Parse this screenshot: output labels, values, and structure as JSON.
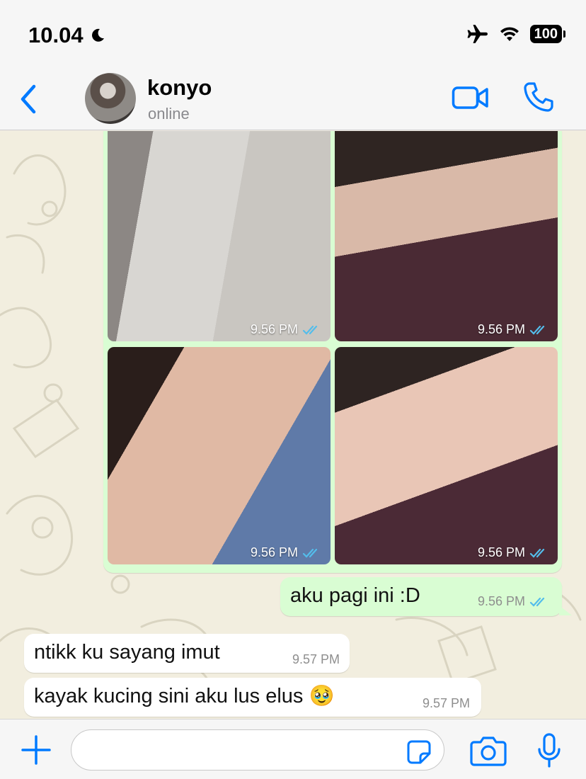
{
  "status_bar": {
    "time": "10.04",
    "battery": "100",
    "icons": [
      "moon-icon",
      "airplane-mode-icon",
      "wifi-icon",
      "battery-icon"
    ]
  },
  "header": {
    "contact_name": "konyo",
    "contact_status": "online",
    "icons": [
      "back-chevron-icon",
      "video-call-icon",
      "phone-call-icon"
    ]
  },
  "chat": {
    "photos": [
      {
        "time": "9.56 PM",
        "status": "read"
      },
      {
        "time": "9.56 PM",
        "status": "read"
      },
      {
        "time": "9.56 PM",
        "status": "read"
      },
      {
        "time": "9.56 PM",
        "status": "read"
      }
    ],
    "messages": [
      {
        "direction": "outgoing",
        "text": "aku pagi ini :D",
        "time": "9.56 PM",
        "status": "read"
      },
      {
        "direction": "incoming",
        "text": "ntikk ku sayang imut",
        "time": "9.57 PM"
      },
      {
        "direction": "incoming",
        "text": "kayak kucing sini aku lus elus 🥹",
        "time": "9.57 PM"
      }
    ]
  },
  "input_bar": {
    "value": "",
    "icons": [
      "plus-icon",
      "sticker-icon",
      "camera-icon",
      "microphone-icon"
    ]
  },
  "colors": {
    "accent": "#007aff",
    "outgoing_bubble": "#d9fdd3",
    "incoming_bubble": "#ffffff",
    "read_ticks": "#53bdeb"
  }
}
